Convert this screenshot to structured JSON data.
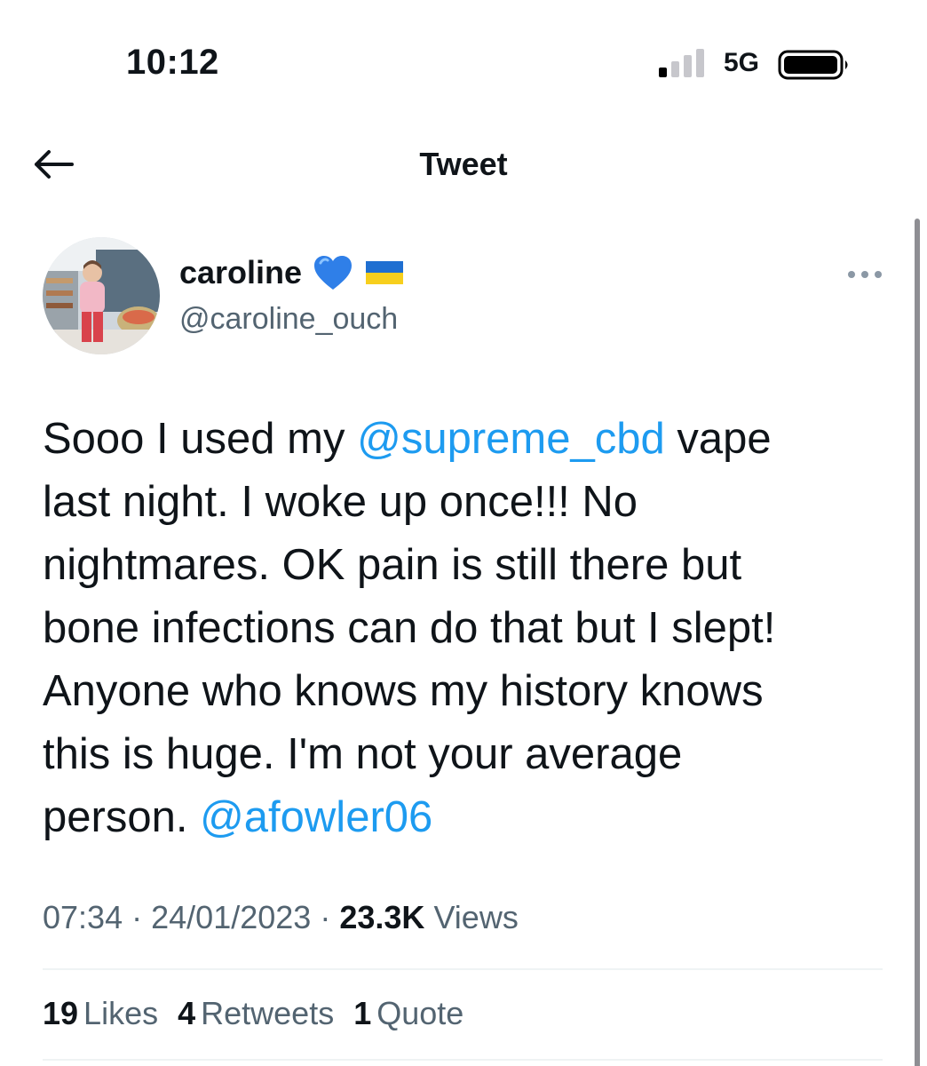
{
  "status_bar": {
    "time": "10:12",
    "network": "5G",
    "signal_bars_filled": 1,
    "signal_bars_total": 4
  },
  "header": {
    "back_icon": "arrow-left-icon",
    "title": "Tweet"
  },
  "tweet": {
    "author": {
      "name": "caroline",
      "handle": "@caroline_ouch",
      "badges": [
        "blue-heart-icon",
        "ukraine-flag-icon"
      ]
    },
    "text_lines": [
      [
        {
          "t": "Sooo I used my "
        },
        {
          "t": "@supreme_cbd",
          "m": true
        },
        {
          "t": " vape"
        }
      ],
      [
        {
          "t": "last night.  I woke up once!!!  No"
        }
      ],
      [
        {
          "t": "nightmares.  OK pain is still there but"
        }
      ],
      [
        {
          "t": "bone infections can do that but I slept!"
        }
      ],
      [
        {
          "t": "Anyone who knows my history knows"
        }
      ],
      [
        {
          "t": "this is huge.  I'm not your average"
        }
      ],
      [
        {
          "t": "person. "
        },
        {
          "t": "@afowler06",
          "m": true
        }
      ]
    ],
    "time": "07:34",
    "date": "24/01/2023",
    "views_count": "23.3K",
    "views_label": "Views",
    "separator": "·",
    "stats": {
      "likes_count": "19",
      "likes_label": "Likes",
      "retweets_count": "4",
      "retweets_label": "Retweets",
      "quotes_count": "1",
      "quotes_label": "Quote"
    }
  },
  "colors": {
    "text": "#0f1419",
    "secondary": "#536471",
    "link": "#1d9bf0",
    "divider": "#eff3f4"
  }
}
